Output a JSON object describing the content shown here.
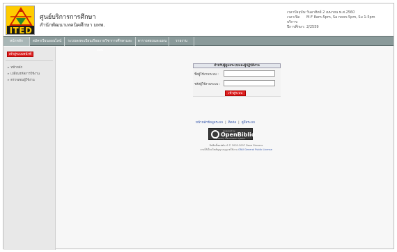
{
  "header": {
    "logo_text": "ITED",
    "title": "ศูนย์บริการการศึกษา",
    "subtitle": "สำนักพัฒนาเทคนิคศึกษา มทพ."
  },
  "info": [
    {
      "label": "เวลาปัจจุบัน:",
      "value": "วันอาทิตย์ 2 เมษายน พ.ศ.2560"
    },
    {
      "label": "เวลาเปิดบริการ:",
      "value": "M-F 8am-5pm, Sa noon-5pm, Su 1-5pm"
    },
    {
      "label": "ปีการศึกษา:",
      "value": "2/2559"
    }
  ],
  "menu": [
    {
      "label": "หน้าหลัก",
      "active": true
    },
    {
      "label": "สมัครเรียนออนไลน์",
      "active": false
    },
    {
      "label": "ระบบลงทะเบียนเรียนรายวิชาการศึกษาและสอบ",
      "active": false
    },
    {
      "label": "ตารางสอบและแผน",
      "active": false
    },
    {
      "label": "รายงาน",
      "active": false
    }
  ],
  "sidebar": {
    "button_label": "เข้าสู่ระบบหน้าที่",
    "items": [
      "หน้าหลัก",
      "เปลี่ยนรหัสการใช้งาน",
      "ตรวจสอบผู้ใช้งาน"
    ]
  },
  "login": {
    "heading": "สำหรับผู้ดูแลระบบและผู้ปฏิบัติงาน",
    "username_label": "ชื่อผู้ใช้งานระบบ :",
    "username_value": "",
    "password_label": "รหัสผู้ใช้งานระบบ :",
    "password_value": "",
    "submit_label": "เข้าสู่ระบบ"
  },
  "footer": {
    "links": [
      "หน้าหลักข้อมูลระบบ",
      "ติดต่อ",
      "คู่มือระบบ"
    ],
    "badge_top": "powered by",
    "badge_main": "OpenBiblio",
    "badge_bottom": "a library information system",
    "copyright": "ลิขสิทธิ์ซอฟต์แวร์ © 2002-2007 Dave Stevens",
    "license_prefix": "ภายใต้เงื่อนไขสัญญาอนุญาตใช้งาน",
    "license_link": "GNU General Public License"
  },
  "colors": {
    "menu_bg": "#8a9a9a",
    "accent_red": "#dd2222",
    "logo_yellow": "#ffcc00"
  }
}
